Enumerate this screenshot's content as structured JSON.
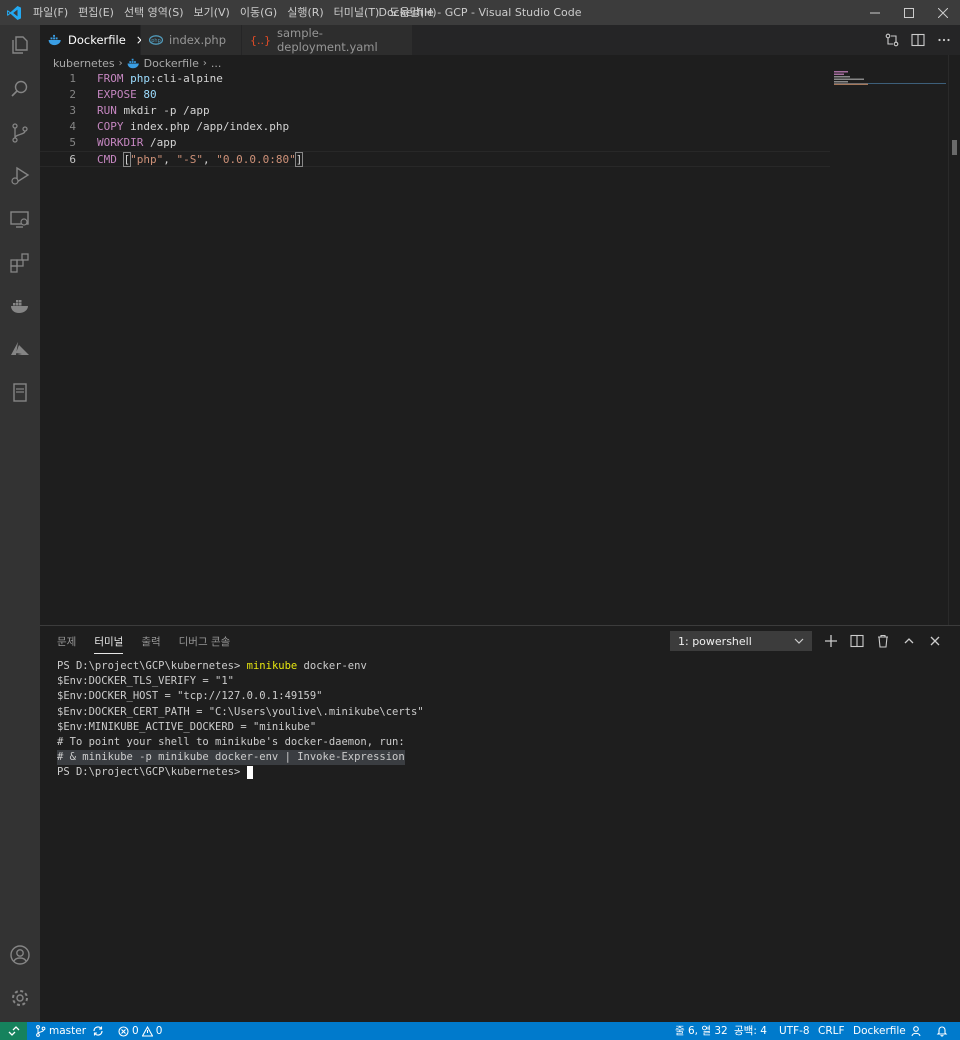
{
  "window": {
    "title": "Dockerfile - GCP - Visual Studio Code",
    "menu": [
      "파일(F)",
      "편집(E)",
      "선택 영역(S)",
      "보기(V)",
      "이동(G)",
      "실행(R)",
      "터미널(T)",
      "도움말(H)"
    ]
  },
  "tabs": [
    {
      "label": "Dockerfile",
      "icon": "docker-icon",
      "active": true,
      "close": "×"
    },
    {
      "label": "index.php",
      "icon": "php-icon",
      "active": false
    },
    {
      "label": "sample-deployment.yaml",
      "icon": "braces-icon",
      "active": false
    }
  ],
  "breadcrumb": {
    "folder": "kubernetes",
    "file": "Dockerfile",
    "more": "..."
  },
  "editor": {
    "lines": [
      {
        "num": "1",
        "tokens": [
          {
            "t": "FROM ",
            "c": "kw"
          },
          {
            "t": "php",
            "c": "id"
          },
          {
            "t": ":cli-alpine",
            "c": "plain"
          }
        ]
      },
      {
        "num": "2",
        "tokens": [
          {
            "t": "EXPOSE ",
            "c": "kw"
          },
          {
            "t": "80",
            "c": "id"
          }
        ]
      },
      {
        "num": "3",
        "tokens": [
          {
            "t": "RUN ",
            "c": "kw"
          },
          {
            "t": "mkdir -p /app",
            "c": "plain"
          }
        ]
      },
      {
        "num": "4",
        "tokens": [
          {
            "t": "COPY ",
            "c": "kw"
          },
          {
            "t": "index.php /app/index.php",
            "c": "plain"
          }
        ]
      },
      {
        "num": "5",
        "tokens": [
          {
            "t": "WORKDIR ",
            "c": "kw"
          },
          {
            "t": "/app",
            "c": "plain"
          }
        ]
      },
      {
        "num": "6",
        "tokens": [
          {
            "t": "CMD ",
            "c": "kw"
          },
          {
            "t": "[",
            "c": "plain"
          },
          {
            "t": "\"php\"",
            "c": "str"
          },
          {
            "t": ", ",
            "c": "plain"
          },
          {
            "t": "\"-S\"",
            "c": "str"
          },
          {
            "t": ", ",
            "c": "plain"
          },
          {
            "t": "\"0.0.0.0:80\"",
            "c": "str"
          },
          {
            "t": "]",
            "c": "plain"
          }
        ]
      }
    ],
    "active_line": 6
  },
  "panel": {
    "tabs": [
      "문제",
      "터미널",
      "출력",
      "디버그 콘솔"
    ],
    "active_tab": "터미널",
    "terminal_select": "1: powershell",
    "terminal_lines": [
      {
        "prompt": "PS D:\\project\\GCP\\kubernetes> ",
        "cmd": "minikube",
        "rest": " docker-env"
      },
      {
        "text": "$Env:DOCKER_TLS_VERIFY = \"1\""
      },
      {
        "text": "$Env:DOCKER_HOST = \"tcp://127.0.0.1:49159\""
      },
      {
        "text": "$Env:DOCKER_CERT_PATH = \"C:\\Users\\youlive\\.minikube\\certs\""
      },
      {
        "text": "$Env:MINIKUBE_ACTIVE_DOCKERD = \"minikube\""
      },
      {
        "text": "# To point your shell to minikube's docker-daemon, run:"
      },
      {
        "text": "# & minikube -p minikube docker-env | Invoke-Expression",
        "selected": true
      },
      {
        "text": "PS D:\\project\\GCP\\kubernetes> ",
        "cursor": true
      }
    ]
  },
  "statusbar": {
    "branch": "master",
    "errors": "0",
    "warnings": "0",
    "position": "줄 6, 열 32",
    "indent": "공백: 4",
    "encoding": "UTF-8",
    "eol": "CRLF",
    "language": "Dockerfile"
  },
  "colors": {
    "accent": "#007acc",
    "remote": "#16825d",
    "keyword": "#c586c0",
    "string": "#ce9178",
    "identifier": "#9cdcfe"
  }
}
